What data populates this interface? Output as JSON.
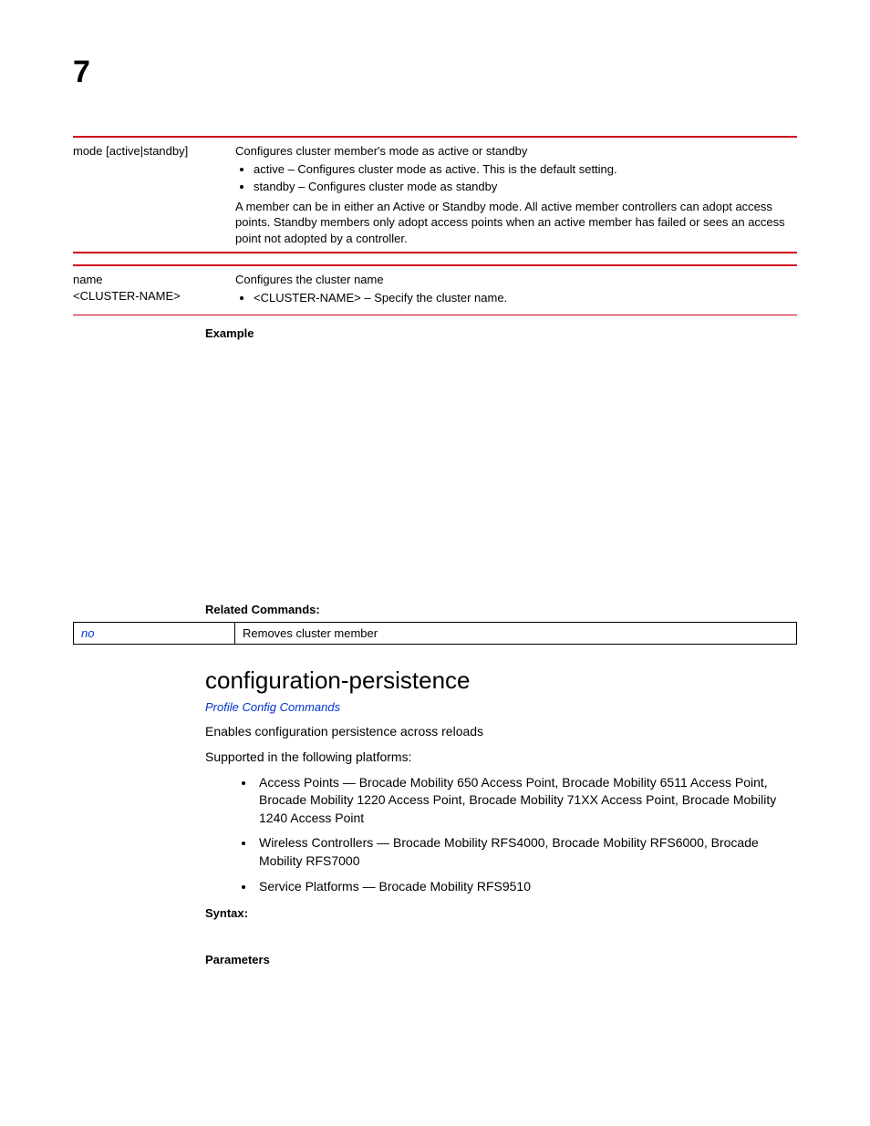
{
  "chapter": "7",
  "table1": {
    "term": "mode [active|standby]",
    "intro": "Configures cluster member's mode as active or standby",
    "items": [
      "active – Configures cluster mode as active. This is the default setting.",
      "standby – Configures cluster mode as standby"
    ],
    "note": "A member can be in either an Active or Standby mode. All active member controllers can adopt access points. Standby members only adopt access points when an active member has failed or sees an access point not adopted by a controller."
  },
  "table2": {
    "term_line1": "name",
    "term_line2": "<CLUSTER-NAME>",
    "intro": "Configures the cluster name",
    "items": [
      "<CLUSTER-NAME> – Specify the cluster name."
    ]
  },
  "labels": {
    "example": "Example",
    "related": "Related Commands:",
    "syntax": "Syntax:",
    "parameters": "Parameters"
  },
  "related_table": {
    "cmd": "no",
    "desc": "Removes cluster member"
  },
  "section": {
    "heading": "configuration-persistence",
    "link": "Profile Config Commands",
    "desc": "Enables configuration persistence across reloads",
    "supported_intro": "Supported in the following platforms:",
    "platforms": [
      "Access Points — Brocade Mobility 650 Access Point, Brocade Mobility 6511 Access Point, Brocade Mobility 1220 Access Point, Brocade Mobility 71XX Access Point, Brocade Mobility 1240 Access Point",
      "Wireless Controllers — Brocade Mobility RFS4000, Brocade Mobility RFS6000, Brocade Mobility RFS7000",
      "Service Platforms — Brocade Mobility RFS9510"
    ]
  }
}
